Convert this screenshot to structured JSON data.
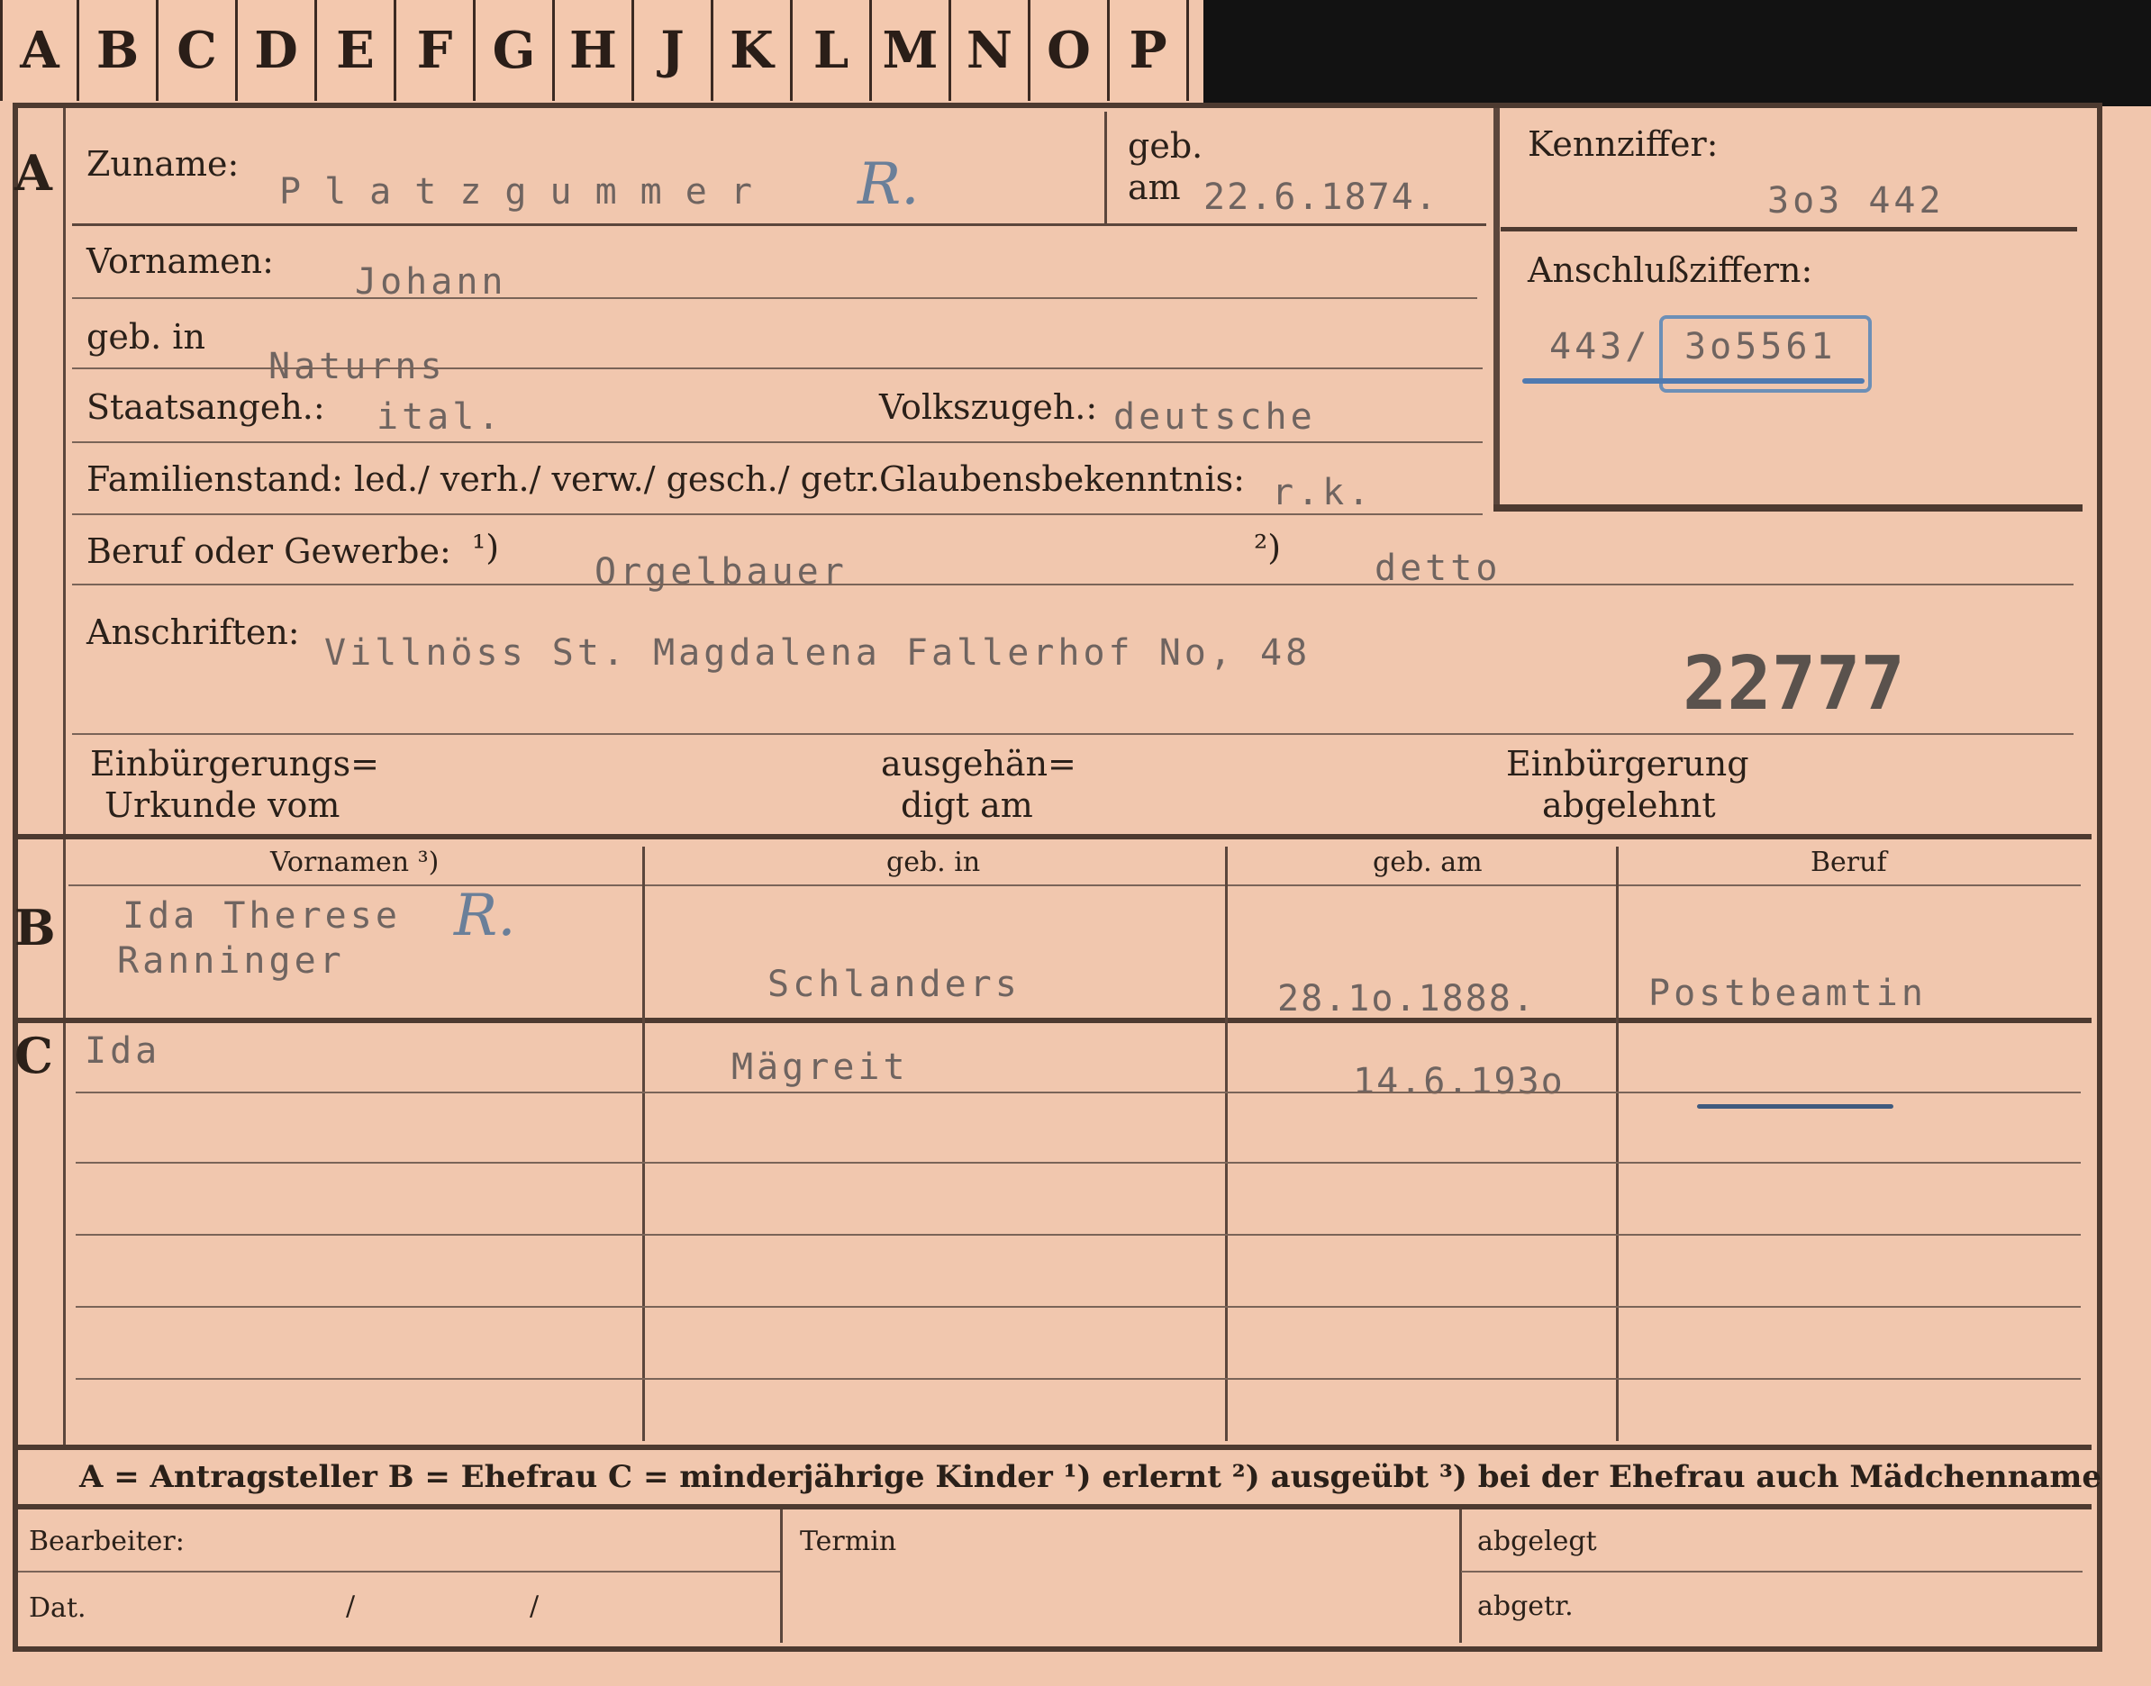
{
  "tabs": [
    "A",
    "B",
    "C",
    "D",
    "E",
    "F",
    "G",
    "H",
    "J",
    "K",
    "L",
    "M",
    "N",
    "O",
    "P"
  ],
  "section_a": {
    "marker": "A",
    "zuname_label": "Zuname:",
    "zuname_value": "Platzgummer",
    "zuname_mark": "R.",
    "geb_label": "geb.",
    "am_label": "am",
    "geb_am_value": "22.6.1874.",
    "kennziffer_label": "Kennziffer:",
    "kennziffer_value": "3o3 442",
    "anschluss_label": "Anschlußziffern:",
    "anschluss_prefix": "443/",
    "anschluss_value": "3o5561",
    "vornamen_label": "Vornamen:",
    "vornamen_value": "Johann",
    "geb_in_label": "geb. in",
    "geb_in_value": "Naturns",
    "staatsangeh_label": "Staatsangeh.:",
    "staatsangeh_value": "ital.",
    "volkszugeh_label": "Volkszugeh.:",
    "volkszugeh_value": "deutsche",
    "familienstand_label": "Familienstand: led./ verh./ verw./ gesch./ getr.",
    "glaubens_label": "Glaubensbekenntnis:",
    "glaubens_value": "r.k.",
    "beruf_label": "Beruf oder Gewerbe:",
    "beruf_note1": "¹)",
    "beruf_value1": "Orgelbauer",
    "beruf_note2": "²)",
    "beruf_value2": "detto",
    "anschriften_label": "Anschriften:",
    "anschriften_value": "Villnöss St. Magdalena  Fallerhof No, 48",
    "big_number": "22777",
    "einb_urkunde_l1": "Einbürgerungs=",
    "einb_urkunde_l2": "Urkunde vom",
    "ausgehaen_l1": "ausgehän=",
    "ausgehaen_l2": "digt am",
    "einb_abgelehnt_l1": "Einbürgerung",
    "einb_abgelehnt_l2": "abgelehnt"
  },
  "section_b": {
    "marker": "B",
    "headers": [
      "Vornamen ³)",
      "geb. in",
      "geb. am",
      "Beruf"
    ],
    "vornamen_line1": "Ida Therese",
    "vornamen_mark": "R.",
    "vornamen_line2": "Ranninger",
    "geb_in": "Schlanders",
    "geb_am": "28.1o.1888.",
    "beruf": "Postbeamtin"
  },
  "section_c": {
    "marker": "C",
    "rows": [
      {
        "vorname": "Ida",
        "geb_in": "Mägreit",
        "geb_am": "14.6.193o",
        "beruf": ""
      }
    ]
  },
  "legend": "A = Antragsteller   B = Ehefrau   C = minderjährige Kinder   ¹) erlernt   ²) ausgeübt   ³) bei der Ehefrau auch Mädchenname",
  "footer": {
    "bearbeiter_label": "Bearbeiter:",
    "dat_label": "Dat.",
    "dat_slash1": "/",
    "dat_slash2": "/",
    "termin_label": "Termin",
    "abgelegt_label": "abgelegt",
    "abgetr_label": "abgetr."
  },
  "colors": {
    "paper": "#f1c6ad",
    "ink": "#2b2019",
    "typewriter": "#6f6460",
    "stamp_blue": "#4f7ab0",
    "tab_bar_black": "#121212"
  }
}
